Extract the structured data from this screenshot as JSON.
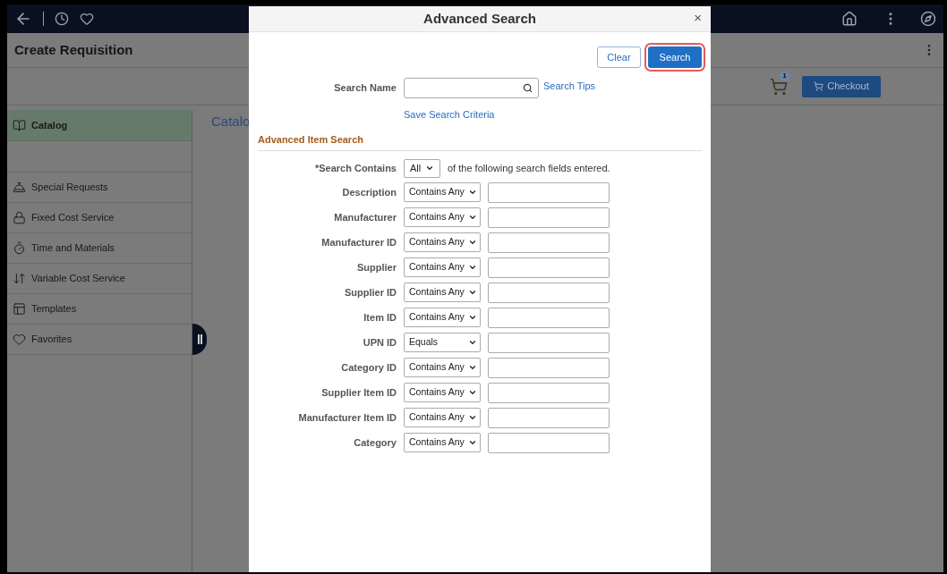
{
  "page": {
    "title": "Create Requisition",
    "cart_count": "1",
    "checkout": "Checkout"
  },
  "sidebar": {
    "items": [
      {
        "label": "Catalog",
        "selected": true
      },
      {
        "label": "Special Requests",
        "selected": false
      },
      {
        "label": "Fixed Cost Service",
        "selected": false
      },
      {
        "label": "Time and Materials",
        "selected": false
      },
      {
        "label": "Variable Cost Service",
        "selected": false
      },
      {
        "label": "Templates",
        "selected": false
      },
      {
        "label": "Favorites",
        "selected": false
      }
    ]
  },
  "content": {
    "heading": "Catalo"
  },
  "dialog": {
    "title": "Advanced Search",
    "close": "×",
    "buttons": [
      {
        "label": "Clear",
        "kind": "secondary",
        "highlighted": false
      },
      {
        "label": "Search",
        "kind": "primary",
        "highlighted": true
      }
    ],
    "search_name": {
      "label": "Search Name"
    },
    "search_tips": "Search Tips",
    "save_criteria": "Save Search Criteria",
    "section": "Advanced Item Search",
    "search_contains": {
      "label": "*Search Contains",
      "value": "All",
      "suffix": "of the following search fields entered."
    },
    "fields": [
      {
        "label": "Description",
        "operator": "Contains Any"
      },
      {
        "label": "Manufacturer",
        "operator": "Contains Any"
      },
      {
        "label": "Manufacturer ID",
        "operator": "Contains Any"
      },
      {
        "label": "Supplier",
        "operator": "Contains Any"
      },
      {
        "label": "Supplier ID",
        "operator": "Contains Any"
      },
      {
        "label": "Item ID",
        "operator": "Contains Any"
      },
      {
        "label": "UPN ID",
        "operator": "Equals"
      },
      {
        "label": "Category ID",
        "operator": "Contains Any"
      },
      {
        "label": "Supplier Item ID",
        "operator": "Contains Any"
      },
      {
        "label": "Manufacturer Item ID",
        "operator": "Contains Any"
      },
      {
        "label": "Category",
        "operator": "Contains Any"
      }
    ]
  }
}
